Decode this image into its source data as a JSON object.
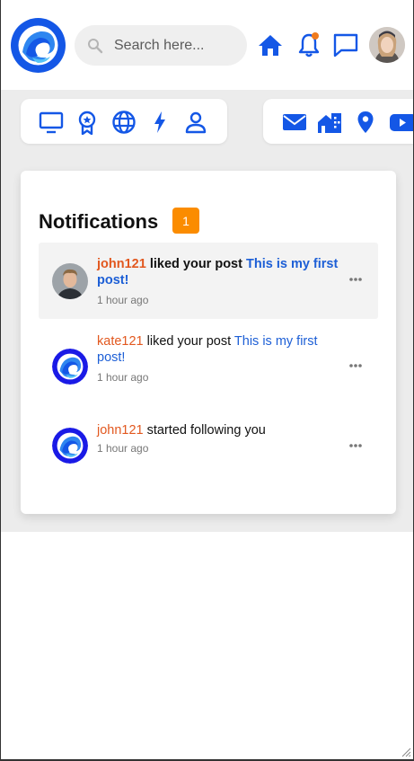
{
  "header": {
    "logo": "app-logo",
    "search": {
      "placeholder": "Search here...",
      "value": ""
    },
    "icons": [
      "home-icon",
      "bell-icon",
      "chat-icon"
    ],
    "notification_dot_color": "#f07b1d",
    "accent_color": "#1457e6"
  },
  "quick_nav": {
    "group1": [
      "monitor-icon",
      "badge-icon",
      "globe-icon",
      "lightning-icon",
      "user-icon"
    ],
    "group2": [
      "mail-icon",
      "building-icon",
      "location-icon",
      "youtube-icon"
    ]
  },
  "notifications": {
    "title": "Notifications",
    "count": "1",
    "badge_color": "#fb8c00",
    "items": [
      {
        "user": "john121",
        "action": " liked your post ",
        "post": "This is my first post!",
        "time": "1 hour ago",
        "unread": true
      },
      {
        "user": "kate121",
        "action": " liked your post ",
        "post": "This is my first post!",
        "time": "1 hour ago",
        "unread": false
      },
      {
        "user": "john121",
        "action": " started following you",
        "post": "",
        "time": "1 hour ago",
        "unread": false
      }
    ]
  }
}
